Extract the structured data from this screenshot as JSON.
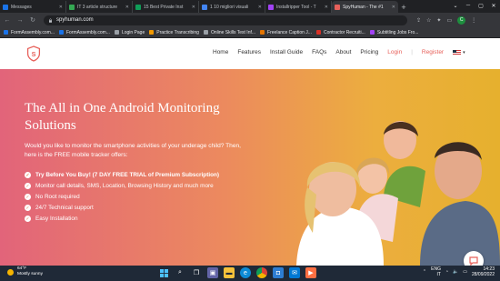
{
  "browser": {
    "tabs": [
      {
        "title": "Messages",
        "color": "#1a73e8",
        "active": false
      },
      {
        "title": "IT 3 article structure",
        "color": "#34a853",
        "active": false
      },
      {
        "title": "15 Best Private Inst",
        "color": "#0f9d58",
        "active": false
      },
      {
        "title": "1 10 migliori visuali",
        "color": "#4285f4",
        "active": false
      },
      {
        "title": "Installripper Tool - T",
        "color": "#a142f4",
        "active": false
      },
      {
        "title": "SpyHuman - The #1",
        "color": "#e7605a",
        "active": true
      }
    ],
    "url": "spyhuman.com",
    "profile_initial": "C",
    "bookmarks": [
      {
        "label": "FormAssembly.com...",
        "color": "#1a73e8"
      },
      {
        "label": "FormAssembly.com...",
        "color": "#1a73e8"
      },
      {
        "label": "Login Page",
        "color": "#9aa0a6"
      },
      {
        "label": "Practice Transcribing",
        "color": "#f29900"
      },
      {
        "label": "Online Skills Test Inf...",
        "color": "#9aa0a6"
      },
      {
        "label": "Freelance Caption J...",
        "color": "#e37400"
      },
      {
        "label": "Contractor Recruiti...",
        "color": "#d93025"
      },
      {
        "label": "Subtitling Jobs Fro...",
        "color": "#a142f4"
      }
    ]
  },
  "site": {
    "nav": [
      "Home",
      "Features",
      "Install Guide",
      "FAQs",
      "About",
      "Pricing"
    ],
    "login": "Login",
    "separator": "|",
    "register": "Register",
    "hero_title": "The All in One Android Monitoring Solutions",
    "hero_intro": "Would you like to monitor the smartphone activities of your underage child? Then, here is the FREE mobile tracker offers:",
    "features": [
      {
        "text": "Try Before You Buy! (7 DAY FREE TRIAL of Premium Subscription)",
        "bold": true
      },
      {
        "text": "Monitor call details, SMS, Location, Browsing History and much more",
        "bold": false
      },
      {
        "text": "No Root required",
        "bold": false
      },
      {
        "text": "24/7 Technical support",
        "bold": false
      },
      {
        "text": "Easy Installation",
        "bold": false
      }
    ]
  },
  "taskbar": {
    "temp": "64°F",
    "weather": "Mostly sunny",
    "lang": "ENG",
    "region": "IT",
    "time": "14:23",
    "date": "28/09/2022"
  }
}
